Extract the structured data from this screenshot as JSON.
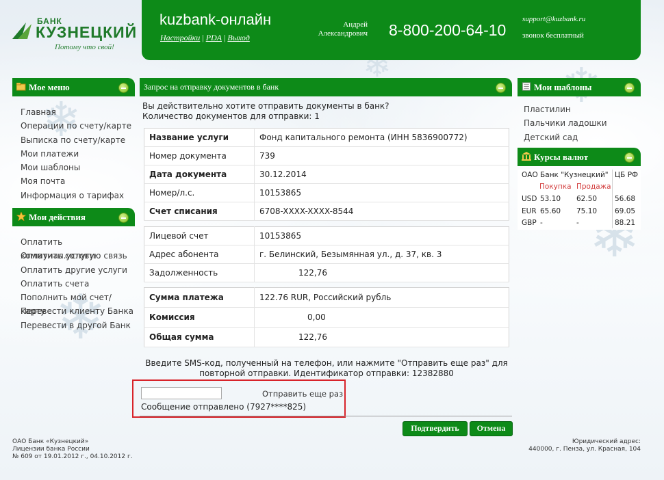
{
  "logo": {
    "line1": "БАНК",
    "line2": "КУЗНЕЦКИЙ",
    "slogan": "Потому что свой!"
  },
  "header": {
    "site_title": "kuzbank-онлайн",
    "links": [
      "Настройки",
      "PDA",
      "Выход"
    ],
    "user_first": "Андрей",
    "user_last": "Александрович",
    "phone": "8-800-200-64-10",
    "email": "support@kuzbank.ru",
    "call_free": "звонок бесплатный"
  },
  "my_menu": {
    "title": "Мое меню",
    "items": [
      "Главная",
      "Операции по счету/карте",
      "Выписка по счету/карте",
      "Мои платежи",
      "Мои шаблоны",
      "Моя почта",
      "Информация о тарифах"
    ]
  },
  "my_actions": {
    "title": "Мои действия",
    "items": [
      "Оплатить коммунал.услуги",
      "Оплатить сотовую связь",
      "Оплатить другие услуги",
      "Оплатить счета",
      "Пополнить мой счет/карту",
      "Перевести клиенту Банка",
      "Перевести в другой Банк"
    ]
  },
  "main": {
    "title": "Запрос на отправку документов в банк",
    "question": "Вы действительно хотите отправить документы в банк?",
    "count_line": "Количество документов для отправки: 1",
    "table1": [
      {
        "k": "Название услуги",
        "v": "Фонд капитального ремонта (ИНН 5836900772)",
        "bold": true
      },
      {
        "k": "Номер документа",
        "v": "739",
        "bold": false
      },
      {
        "k": "Дата документа",
        "v": "30.12.2014",
        "bold": true
      },
      {
        "k": "Номер/л.с.",
        "v": "10153865",
        "bold": false
      },
      {
        "k": "Счет списания",
        "v": "6708-XXXX-XXXX-8544",
        "bold": true
      }
    ],
    "table2": [
      {
        "k": "Лицевой счет",
        "v": "10153865"
      },
      {
        "k": "Адрес абонента",
        "v": "г. Белинский, Безымянная ул., д. 37, кв. 3"
      },
      {
        "k": "Задолженность",
        "v": "122,76"
      }
    ],
    "table3": [
      {
        "k": "Сумма платежа",
        "v": "122.76 RUR, Российский рубль"
      },
      {
        "k": "Комиссия",
        "v": "0,00"
      },
      {
        "k": "Общая сумма",
        "v": "122,76"
      }
    ],
    "sms_line1": "Введите SMS-код, полученный на телефон, или нажмите \"Отправить еще раз\" для",
    "sms_line2": "повторной отправки. Идентификатор отправки: 12382880",
    "sms_input_value": "",
    "resend_label": "Отправить еще раз",
    "sent_message": "Сообщение отправлено (7927****825)",
    "confirm_label": "Подтвердить",
    "cancel_label": "Отмена"
  },
  "templates": {
    "title": "Мои шаблоны",
    "items": [
      "Пластилин",
      "Пальчики ладошки",
      "Детский сад"
    ]
  },
  "rates": {
    "title": "Курсы валют",
    "bank_label": "ОАО Банк \"Кузнецкий\"",
    "cb_label": "ЦБ РФ",
    "buy_label": "Покупка",
    "sell_label": "Продажа",
    "rows": [
      {
        "cur": "USD",
        "buy": "53.10",
        "sell": "62.50",
        "cb": "56.68"
      },
      {
        "cur": "EUR",
        "buy": "65.60",
        "sell": "75.10",
        "cb": "69.05"
      },
      {
        "cur": "GBP",
        "buy": "-",
        "sell": "-",
        "cb": "88.21"
      }
    ]
  },
  "footer": {
    "left1": "ОАО Банк «Кузнецкий»",
    "left2": "Лицензии банка России",
    "left3": "№ 609 от 19.01.2012 г., 04.10.2012 г.",
    "right1": "Юридический адрес:",
    "right2": "440000, г. Пенза, ул. Красная, 104"
  },
  "colors": {
    "brand_green": "#0d8a18",
    "highlight_red": "#d8232a",
    "rate_label_red": "#d23a3a"
  }
}
